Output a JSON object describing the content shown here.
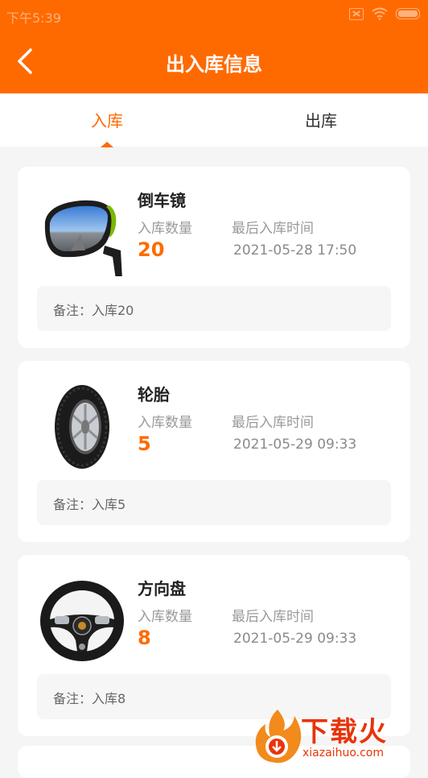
{
  "status_bar": {
    "time": "下午5:39"
  },
  "header": {
    "title": "出入库信息"
  },
  "tabs": [
    {
      "label": "入库",
      "active": true
    },
    {
      "label": "出库",
      "active": false
    }
  ],
  "items": [
    {
      "name": "倒车镜",
      "qty_label": "入库数量",
      "qty": "20",
      "time_label": "最后入库时间",
      "time": "2021-05-28 17:50",
      "note": "备注：入库20",
      "icon": "mirror-icon"
    },
    {
      "name": "轮胎",
      "qty_label": "入库数量",
      "qty": "5",
      "time_label": "最后入库时间",
      "time": "2021-05-29 09:33",
      "note": "备注：入库5",
      "icon": "tire-icon"
    },
    {
      "name": "方向盘",
      "qty_label": "入库数量",
      "qty": "8",
      "time_label": "最后入库时间",
      "time": "2021-05-29 09:33",
      "note": "备注：入库8",
      "icon": "steering-wheel-icon"
    }
  ],
  "watermark": {
    "text": "下载火",
    "url": "xiazaihuo.com"
  },
  "colors": {
    "accent": "#ff6a00",
    "background": "#f5f5f5"
  }
}
